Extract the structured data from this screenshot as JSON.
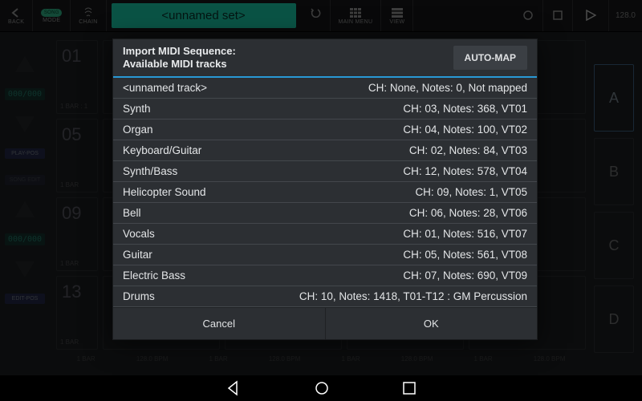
{
  "toolbar": {
    "back": "BACK",
    "mode": "MODE",
    "mode_pill": "SONG",
    "chain": "CHAIN",
    "set_name": "<unnamed set>",
    "main_menu": "MAIN MENU",
    "view": "VIEW",
    "bpm": "128.0"
  },
  "dialog": {
    "title_line1": "Import MIDI Sequence:",
    "title_line2": "Available MIDI tracks",
    "auto_map": "AUTO-MAP",
    "cancel": "Cancel",
    "ok": "OK",
    "rows": [
      {
        "name": "<unnamed track>",
        "meta": "CH: None, Notes: 0, Not mapped"
      },
      {
        "name": "Synth",
        "meta": "CH: 03, Notes: 368, VT01"
      },
      {
        "name": "Organ",
        "meta": "CH: 04, Notes: 100, VT02"
      },
      {
        "name": "Keyboard/Guitar",
        "meta": "CH: 02, Notes: 84, VT03"
      },
      {
        "name": "Synth/Bass",
        "meta": "CH: 12, Notes: 578, VT04"
      },
      {
        "name": "Helicopter Sound",
        "meta": "CH: 09, Notes: 1, VT05"
      },
      {
        "name": "Bell",
        "meta": "CH: 06, Notes: 28, VT06"
      },
      {
        "name": "Vocals",
        "meta": "CH: 01, Notes: 516, VT07"
      },
      {
        "name": "Guitar",
        "meta": "CH: 05, Notes: 561, VT08"
      },
      {
        "name": "Electric Bass",
        "meta": "CH: 07, Notes: 690, VT09"
      },
      {
        "name": "Drums",
        "meta": "CH: 10, Notes: 1418, T01-T12 : GM Percussion"
      }
    ]
  },
  "left": {
    "counter1": "000/000",
    "play_pos": "PLAY-POS",
    "song_edit": "SONG EDIT",
    "counter2": "000/000",
    "edit_pos": "EDIT-POS"
  },
  "bg": {
    "nums": [
      "01",
      "05",
      "09",
      "13"
    ],
    "sub0": "1 BAR : 1",
    "sub": "1 BAR",
    "bpm_label": "128.0 BPM"
  },
  "right_letters": [
    "A",
    "B",
    "C",
    "D"
  ]
}
